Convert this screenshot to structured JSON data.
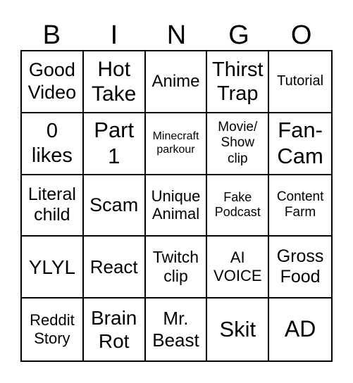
{
  "title_letters": [
    "B",
    "I",
    "N",
    "G",
    "O"
  ],
  "cells": [
    [
      {
        "lines": [
          "Good",
          "Video"
        ],
        "size": 27
      },
      {
        "lines": [
          "Hot",
          "Take"
        ],
        "size": 30
      },
      {
        "lines": [
          "Anime"
        ],
        "size": 24
      },
      {
        "lines": [
          "Thirst",
          "Trap"
        ],
        "size": 29
      },
      {
        "lines": [
          "Tutorial"
        ],
        "size": 20
      }
    ],
    [
      {
        "lines": [
          "0",
          "likes"
        ],
        "size": 29
      },
      {
        "lines": [
          "Part",
          "1"
        ],
        "size": 31
      },
      {
        "lines": [
          "Minecraft",
          "parkour"
        ],
        "size": 16
      },
      {
        "lines": [
          "Movie/",
          "Show",
          "clip"
        ],
        "size": 19
      },
      {
        "lines": [
          "Fan-",
          "Cam"
        ],
        "size": 31
      }
    ],
    [
      {
        "lines": [
          "Literal",
          "child"
        ],
        "size": 25
      },
      {
        "lines": [
          "Scam"
        ],
        "size": 27
      },
      {
        "lines": [
          "Unique",
          "Animal"
        ],
        "size": 22
      },
      {
        "lines": [
          "Fake",
          "Podcast"
        ],
        "size": 18
      },
      {
        "lines": [
          "Content",
          "Farm"
        ],
        "size": 19
      }
    ],
    [
      {
        "lines": [
          "YLYL"
        ],
        "size": 28
      },
      {
        "lines": [
          "React"
        ],
        "size": 26
      },
      {
        "lines": [
          "Twitch",
          "clip"
        ],
        "size": 23
      },
      {
        "lines": [
          "AI",
          "VOICE"
        ],
        "size": 22
      },
      {
        "lines": [
          "Gross",
          "Food"
        ],
        "size": 25
      }
    ],
    [
      {
        "lines": [
          "Reddit",
          "Story"
        ],
        "size": 22
      },
      {
        "lines": [
          "Brain",
          "Rot"
        ],
        "size": 28
      },
      {
        "lines": [
          "Mr.",
          "Beast"
        ],
        "size": 26
      },
      {
        "lines": [
          "Skit"
        ],
        "size": 31
      },
      {
        "lines": [
          "AD"
        ],
        "size": 32
      }
    ]
  ]
}
